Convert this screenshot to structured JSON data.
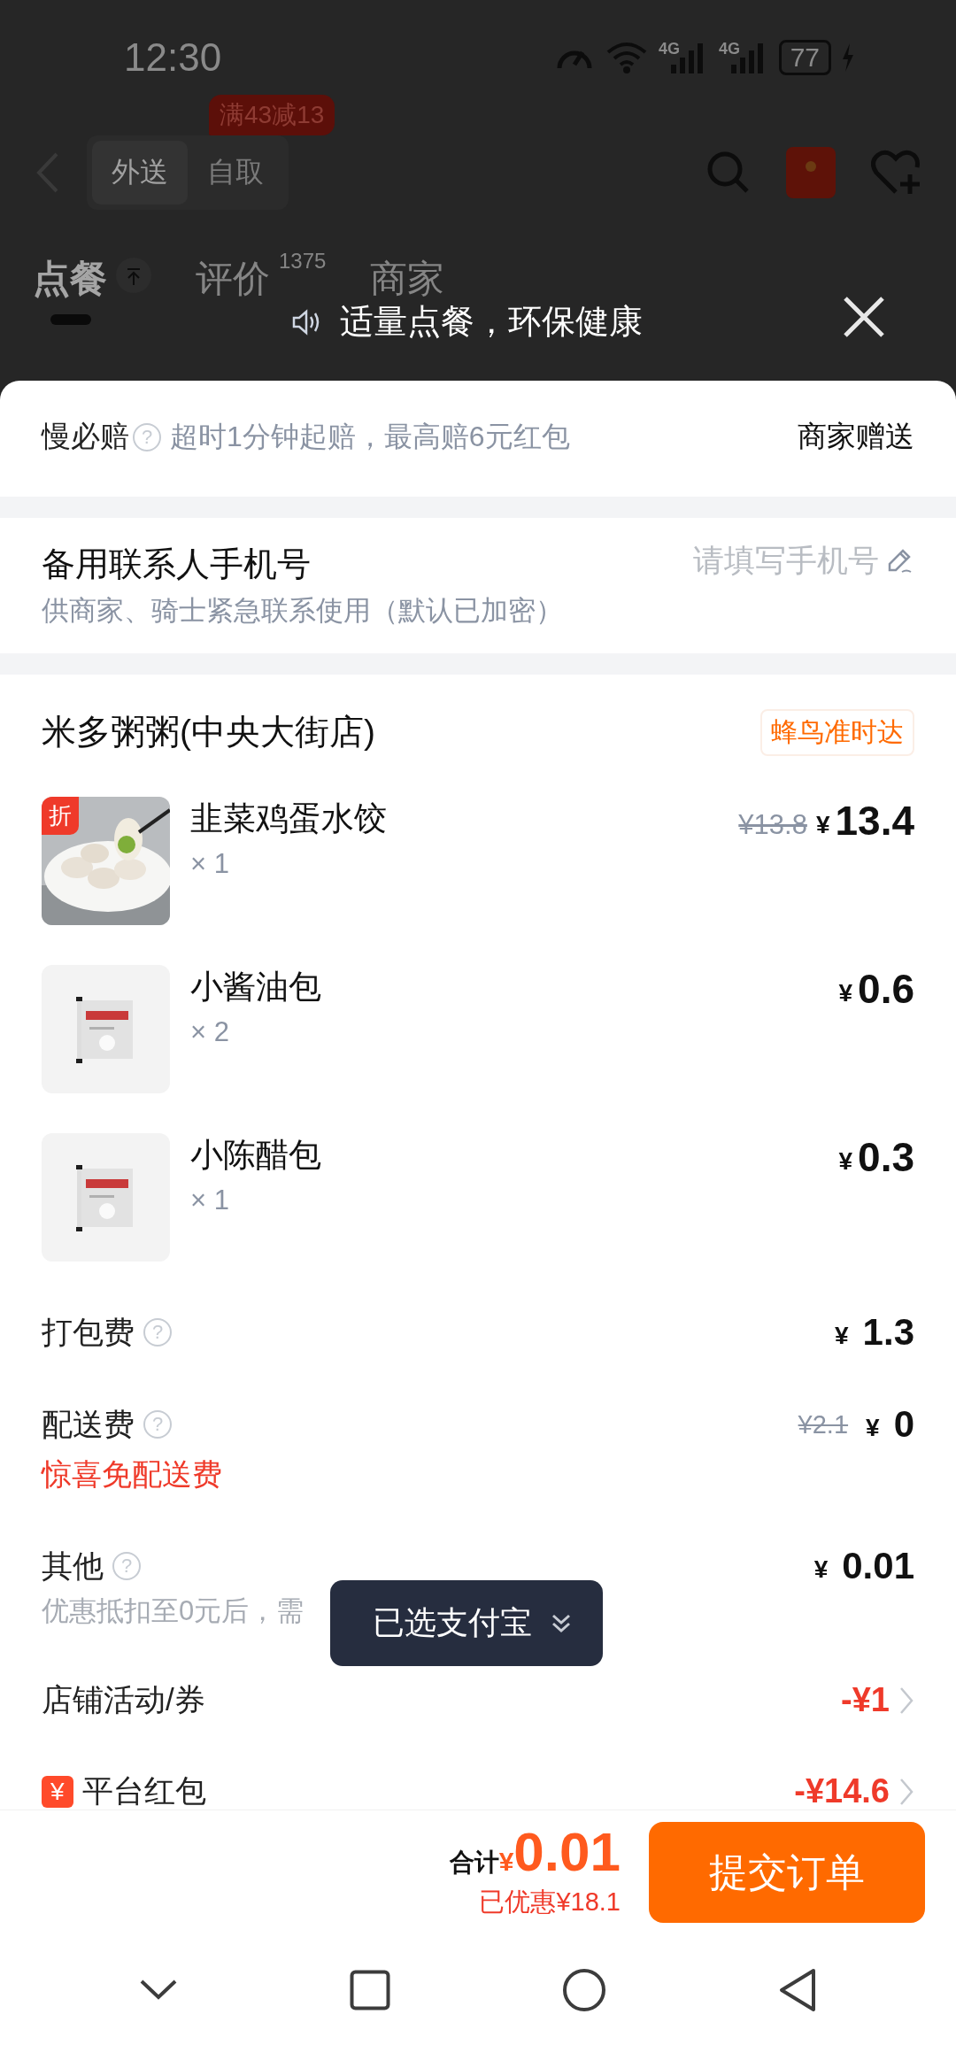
{
  "status_bar": {
    "time": "12:30",
    "networks": [
      "4G",
      "4G"
    ],
    "battery": "77"
  },
  "header": {
    "modes": [
      {
        "label": "外送",
        "selected": true
      },
      {
        "label": "自取",
        "selected": false
      }
    ],
    "promo_badge": "满43减13"
  },
  "page_tabs": [
    {
      "label": "点餐",
      "selected": true
    },
    {
      "label": "评价",
      "count": "1375",
      "selected": false
    },
    {
      "label": "商家",
      "selected": false
    }
  ],
  "notice": {
    "text": "适量点餐，环保健康"
  },
  "compensation": {
    "title": "慢必赔",
    "help": "?",
    "desc": "超时1分钟起赔，最高赔6元红包",
    "action": "商家赠送"
  },
  "contact": {
    "title": "备用联系人手机号",
    "hint": "供商家、骑士紧急联系使用（默认已加密）",
    "placeholder": "请填写手机号"
  },
  "store": {
    "name": "米多粥粥(中央大街店)",
    "tag": "蜂鸟准时达",
    "items": [
      {
        "kind": "dumpling",
        "name": "韭菜鸡蛋水饺",
        "qty": "× 1",
        "badge": "折",
        "original_price": "¥13.8",
        "currency": "¥",
        "price": "13.4"
      },
      {
        "kind": "packet",
        "name": "小酱油包",
        "qty": "× 2",
        "currency": "¥",
        "price": "0.6"
      },
      {
        "kind": "packet",
        "name": "小陈醋包",
        "qty": "× 1",
        "currency": "¥",
        "price": "0.3"
      }
    ]
  },
  "fees": [
    {
      "kind": "fee",
      "label": "打包费",
      "help": "?",
      "currency": "¥",
      "price": "1.3"
    },
    {
      "kind": "fee",
      "label": "配送费",
      "help": "?",
      "original_price": "¥2.1",
      "currency": "¥",
      "price": "0",
      "note": "惊喜免配送费"
    },
    {
      "kind": "fee",
      "label": "其他",
      "help": "?",
      "currency": "¥",
      "price": "0.01",
      "sub": "优惠抵扣至0元后，需"
    },
    {
      "kind": "discount",
      "label": "店铺活动/券",
      "amount": "-¥1"
    },
    {
      "kind": "discount",
      "label": "平台红包",
      "icon_text": "¥",
      "amount": "-¥14.6"
    }
  ],
  "toast": {
    "text": "已选支付宝"
  },
  "footer": {
    "total_label": "合计",
    "currency": "¥",
    "total": "0.01",
    "saved": "已优惠¥18.1",
    "submit": "提交订单"
  }
}
